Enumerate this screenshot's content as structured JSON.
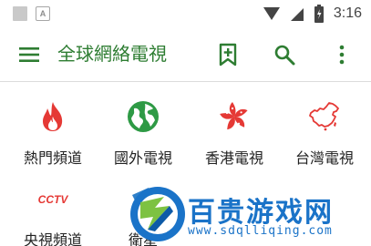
{
  "status_bar": {
    "time": "3:16",
    "a_glyph": "A",
    "icons": [
      "notification-square-icon",
      "notification-a-icon",
      "signal-icon",
      "wifi-icon",
      "battery-icon"
    ]
  },
  "toolbar": {
    "title": "全球網絡電視",
    "icons": [
      "menu-icon",
      "bookmark-add-icon",
      "search-icon",
      "more-vert-icon"
    ]
  },
  "categories": [
    {
      "label": "熱門頻道",
      "icon": "fire-icon"
    },
    {
      "label": "國外電視",
      "icon": "globe-icon"
    },
    {
      "label": "香港電視",
      "icon": "bauhinia-icon"
    },
    {
      "label": "台灣電視",
      "icon": "china-map-icon"
    },
    {
      "label": "央視頻道",
      "icon": "cctv-logo-icon"
    },
    {
      "label": "衛星",
      "icon": "satellite-icon"
    }
  ],
  "cctv_text": "CCTV",
  "watermark": {
    "text": "百贵游戏网",
    "url": "www.sdqlliqing.com"
  },
  "colors": {
    "brand_green": "#2e7d32",
    "fire_red": "#e53935",
    "globe_green": "#2e9a45",
    "watermark_blue": "#1a73c8"
  }
}
